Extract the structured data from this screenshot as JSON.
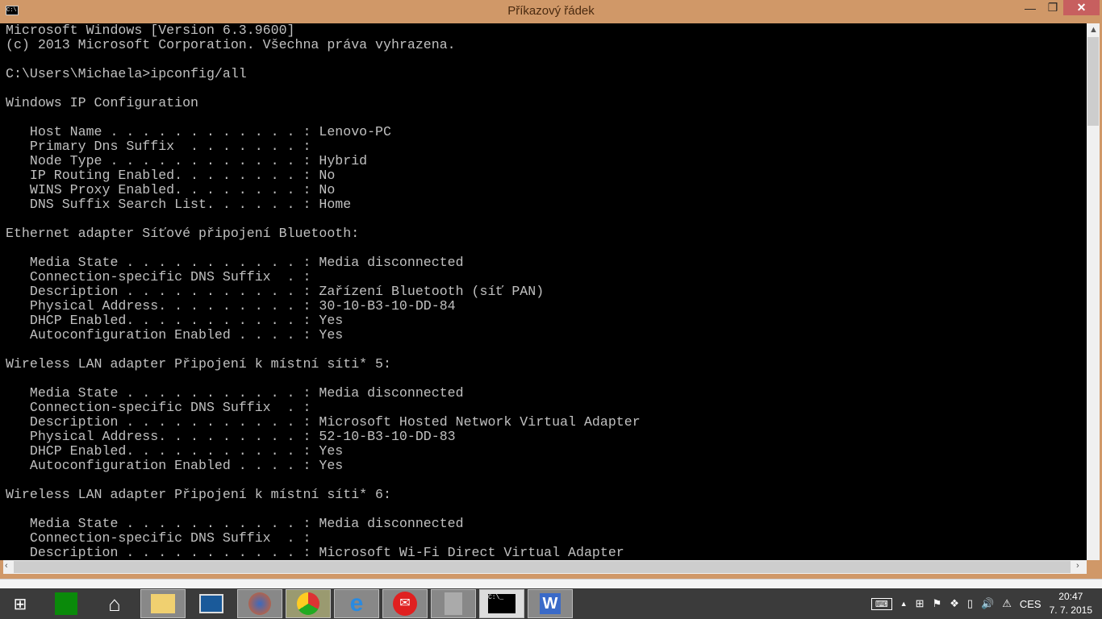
{
  "window": {
    "title": "Příkazový řádek",
    "icon_text": "C:\\"
  },
  "console_lines": [
    "Microsoft Windows [Version 6.3.9600]",
    "(c) 2013 Microsoft Corporation. Všechna práva vyhrazena.",
    "",
    "C:\\Users\\Michaela>ipconfig/all",
    "",
    "Windows IP Configuration",
    "",
    "   Host Name . . . . . . . . . . . . : Lenovo-PC",
    "   Primary Dns Suffix  . . . . . . . :",
    "   Node Type . . . . . . . . . . . . : Hybrid",
    "   IP Routing Enabled. . . . . . . . : No",
    "   WINS Proxy Enabled. . . . . . . . : No",
    "   DNS Suffix Search List. . . . . . : Home",
    "",
    "Ethernet adapter Síťové připojení Bluetooth:",
    "",
    "   Media State . . . . . . . . . . . : Media disconnected",
    "   Connection-specific DNS Suffix  . :",
    "   Description . . . . . . . . . . . : Zařízení Bluetooth (síť PAN)",
    "   Physical Address. . . . . . . . . : 30-10-B3-10-DD-84",
    "   DHCP Enabled. . . . . . . . . . . : Yes",
    "   Autoconfiguration Enabled . . . . : Yes",
    "",
    "Wireless LAN adapter Připojení k místní síti* 5:",
    "",
    "   Media State . . . . . . . . . . . : Media disconnected",
    "   Connection-specific DNS Suffix  . :",
    "   Description . . . . . . . . . . . : Microsoft Hosted Network Virtual Adapter",
    "   Physical Address. . . . . . . . . : 52-10-B3-10-DD-83",
    "   DHCP Enabled. . . . . . . . . . . : Yes",
    "   Autoconfiguration Enabled . . . . : Yes",
    "",
    "Wireless LAN adapter Připojení k místní síti* 6:",
    "",
    "   Media State . . . . . . . . . . . : Media disconnected",
    "   Connection-specific DNS Suffix  . :",
    "   Description . . . . . . . . . . . : Microsoft Wi-Fi Direct Virtual Adapter"
  ],
  "tray": {
    "language": "CES",
    "time": "20:47",
    "date": "7. 7. 2015"
  },
  "taskbar_apps": [
    "start",
    "store",
    "home",
    "file-explorer",
    "lenovo",
    "firefox",
    "chrome",
    "internet-explorer",
    "mail",
    "device-manager",
    "command-prompt",
    "word"
  ],
  "colors": {
    "titlebar": "#d09868",
    "close": "#c75f5f",
    "console_bg": "#000000",
    "console_fg": "#c0c0c0"
  }
}
